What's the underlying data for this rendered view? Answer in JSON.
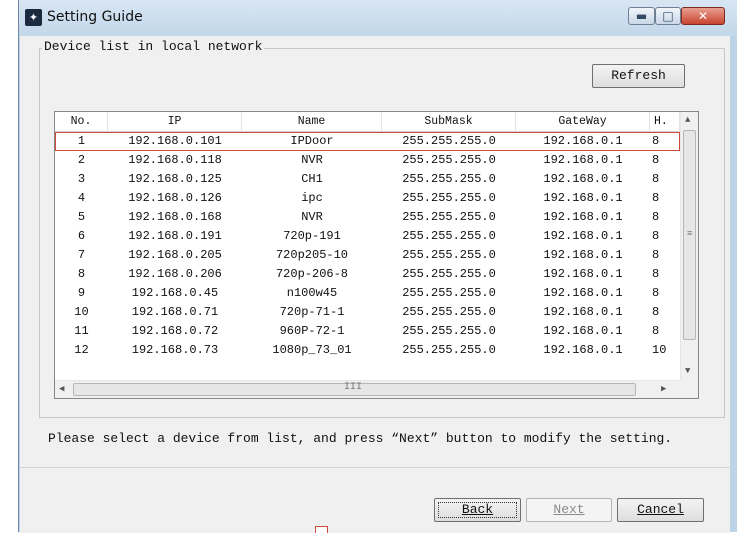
{
  "window": {
    "title": "Setting Guide",
    "controls": {
      "minimize": "▬",
      "maximize": "□",
      "close": "✕"
    }
  },
  "group": {
    "label": "Device list in local network"
  },
  "buttons": {
    "refresh": "Refresh",
    "back": "Back",
    "next": "Next",
    "cancel": "Cancel"
  },
  "table": {
    "columns": [
      "No.",
      "IP",
      "Name",
      "SubMask",
      "GateWay",
      "H."
    ],
    "rows": [
      [
        "1",
        "192.168.0.101",
        "IPDoor",
        "255.255.255.0",
        "192.168.0.1",
        "8"
      ],
      [
        "2",
        "192.168.0.118",
        "NVR",
        "255.255.255.0",
        "192.168.0.1",
        "8"
      ],
      [
        "3",
        "192.168.0.125",
        "CH1",
        "255.255.255.0",
        "192.168.0.1",
        "8"
      ],
      [
        "4",
        "192.168.0.126",
        "ipc",
        "255.255.255.0",
        "192.168.0.1",
        "8"
      ],
      [
        "5",
        "192.168.0.168",
        "NVR",
        "255.255.255.0",
        "192.168.0.1",
        "8"
      ],
      [
        "6",
        "192.168.0.191",
        "720p-191",
        "255.255.255.0",
        "192.168.0.1",
        "8"
      ],
      [
        "7",
        "192.168.0.205",
        "720p205-10",
        "255.255.255.0",
        "192.168.0.1",
        "8"
      ],
      [
        "8",
        "192.168.0.206",
        "720p-206-8",
        "255.255.255.0",
        "192.168.0.1",
        "8"
      ],
      [
        "9",
        "192.168.0.45",
        "n100w45",
        "255.255.255.0",
        "192.168.0.1",
        "8"
      ],
      [
        "10",
        "192.168.0.71",
        "720p-71-1",
        "255.255.255.0",
        "192.168.0.1",
        "8"
      ],
      [
        "11",
        "192.168.0.72",
        "960P-72-1",
        "255.255.255.0",
        "192.168.0.1",
        "8"
      ],
      [
        "12",
        "192.168.0.73",
        "1080p_73_01",
        "255.255.255.0",
        "192.168.0.1",
        "10"
      ]
    ],
    "selected_index": 0
  },
  "scroll": {
    "up": "▲",
    "down": "▼",
    "left": "◀",
    "right": "▶",
    "vgrip": "≡",
    "hgrip": "III"
  },
  "hint": "Please select a device from list, and press “Next” button to modify the setting.",
  "colors": {
    "selection_outline": "#cf4a3a",
    "title_bar": "#c8dbee"
  }
}
